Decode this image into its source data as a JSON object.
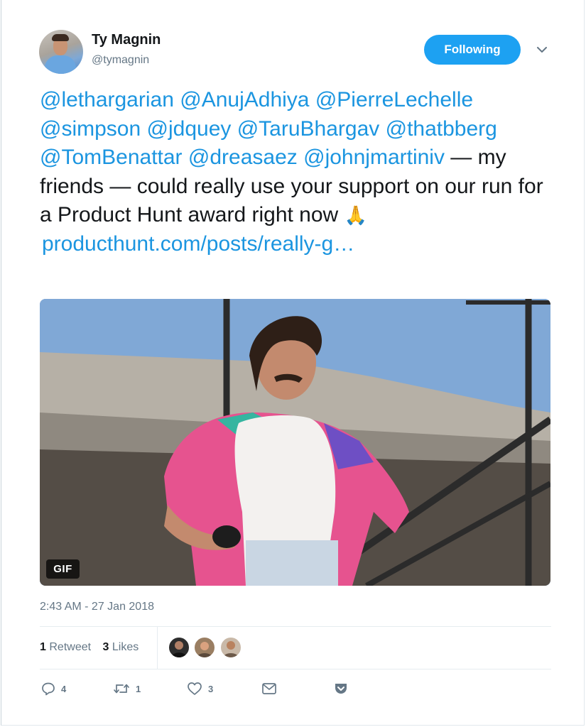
{
  "author": {
    "name": "Ty Magnin",
    "handle": "@tymagnin"
  },
  "follow_button": {
    "label": "Following"
  },
  "tweet": {
    "mentions": [
      "@lethargarian",
      "@AnujAdhiya",
      "@PierreLechelle",
      "@simpson",
      "@jdquey",
      "@TaruBhargav",
      "@thatbberg",
      "@TomBenattar",
      "@dreasaez",
      "@johnjmartiniv"
    ],
    "body_text": " — my friends — could really use your support on our run for a Product Hunt award right now ",
    "emoji": "🙏",
    "link_text": "producthunt.com/posts/really-g…"
  },
  "media": {
    "badge": "GIF"
  },
  "timestamp": "2:43 AM - 27 Jan 2018",
  "stats": {
    "retweets_count": "1",
    "retweets_label": "Retweet",
    "likes_count": "3",
    "likes_label": "Likes"
  },
  "actions": {
    "reply_count": "4",
    "retweet_count": "1",
    "like_count": "3"
  },
  "icons": {
    "caret": "chevron-down-icon",
    "reply": "reply-icon",
    "retweet": "retweet-icon",
    "like": "heart-icon",
    "dm": "envelope-icon",
    "bookmark": "pocket-icon"
  },
  "colors": {
    "brand": "#1da1f2",
    "link": "#1b95e0",
    "text": "#14171a",
    "muted": "#657786"
  }
}
